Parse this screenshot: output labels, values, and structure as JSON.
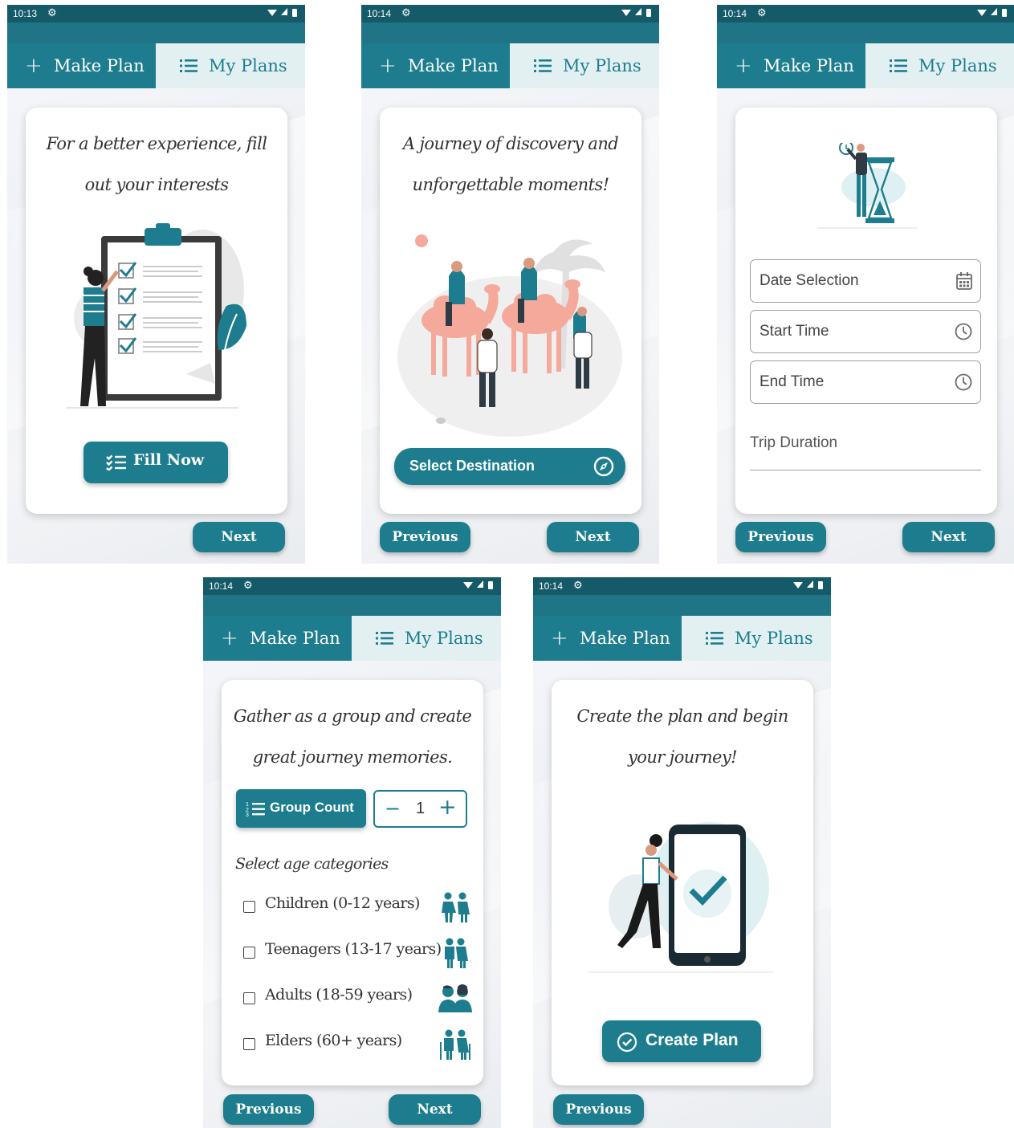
{
  "colors": {
    "primary": "#1d7d8e",
    "status_bar": "#155a68",
    "tab_inactive_bg": "#e3f0f2"
  },
  "tabs": {
    "make_plan": "Make Plan",
    "my_plans": "My Plans"
  },
  "nav": {
    "previous": "Previous",
    "next": "Next"
  },
  "screens": [
    {
      "time": "10:13",
      "title_line1": "For a better experience, fill",
      "title_line2": "out your interests",
      "illustration": "checklist-illustration",
      "action_button": {
        "label": "Fill Now",
        "icon": "checklist-icon"
      }
    },
    {
      "time": "10:14",
      "title_line1": "A journey of discovery and",
      "title_line2": "unforgettable moments!",
      "illustration": "camel-caravan-illustration",
      "action_button": {
        "label": "Select Destination",
        "icon": "compass-icon"
      }
    },
    {
      "time": "10:14",
      "illustration": "hourglass-time-illustration",
      "fields": [
        {
          "label": "Date Selection",
          "icon": "calendar-icon"
        },
        {
          "label": "Start Time",
          "icon": "clock-icon"
        },
        {
          "label": "End Time",
          "icon": "clock-icon"
        }
      ],
      "trip_duration_label": "Trip Duration"
    },
    {
      "time": "10:14",
      "title_line1": "Gather as a group and create",
      "title_line2": "great journey memories.",
      "group_count": {
        "label": "Group Count",
        "value": "1",
        "minus": "−",
        "plus": "+"
      },
      "age_heading": "Select age categories",
      "age_categories": [
        {
          "label": "Children (0-12 years)",
          "icon": "children-icon",
          "checked": false
        },
        {
          "label": "Teenagers (13-17 years)",
          "icon": "teenagers-icon",
          "checked": false
        },
        {
          "label": "Adults (18-59 years)",
          "icon": "adults-icon",
          "checked": false
        },
        {
          "label": "Elders (60+ years)",
          "icon": "elders-icon",
          "checked": false
        }
      ]
    },
    {
      "time": "10:14",
      "title_line1": "Create the plan and begin",
      "title_line2": "your journey!",
      "illustration": "phone-checkmark-illustration",
      "action_button": {
        "label": "Create Plan",
        "icon": "check-circle-icon"
      }
    }
  ]
}
